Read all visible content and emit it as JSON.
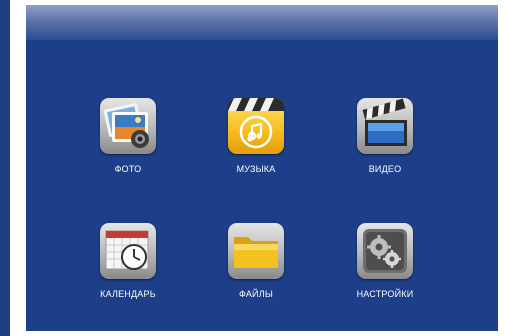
{
  "menu": {
    "items": [
      {
        "label": "ФОТО",
        "icon": "photo-icon"
      },
      {
        "label": "МУЗЫКА",
        "icon": "music-icon"
      },
      {
        "label": "ВИДЕО",
        "icon": "video-icon"
      },
      {
        "label": "КАЛЕНДАРЬ",
        "icon": "calendar-icon"
      },
      {
        "label": "ФАЙЛЫ",
        "icon": "folder-icon"
      },
      {
        "label": "НАСТРОЙКИ",
        "icon": "settings-icon"
      }
    ]
  },
  "colors": {
    "background": "#1d3f89",
    "title_bar": "#5e74aa",
    "label": "#ffffff",
    "music_accent": "#f6bd20",
    "folder": "#f3c21f"
  }
}
